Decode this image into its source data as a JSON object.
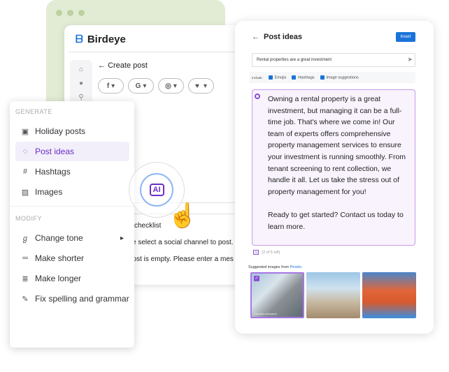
{
  "app": {
    "brand": "Birdeye",
    "page_title": "Create post",
    "sidebar_icons": [
      "home-icon",
      "chat-icon",
      "user-icon"
    ],
    "channels": [
      {
        "icon": "facebook-icon",
        "glyph": "f"
      },
      {
        "icon": "google-icon",
        "glyph": "G"
      },
      {
        "icon": "instagram-icon",
        "glyph": "◎"
      },
      {
        "icon": "twitter-icon",
        "glyph": "🐦"
      }
    ],
    "checklist_label": "checklist",
    "warning1": "se select a social channel to post.",
    "warning2": "post is empty. Please enter a mes"
  },
  "menu": {
    "generate_label": "GENERATE",
    "generate": [
      {
        "label": "Holiday posts",
        "icon": "calendar-icon",
        "glyph": "▣"
      },
      {
        "label": "Post ideas",
        "icon": "lightbulb-icon",
        "glyph": "◌",
        "active": true
      },
      {
        "label": "Hashtags",
        "icon": "hashtag-icon",
        "glyph": "#"
      },
      {
        "label": "Images",
        "icon": "image-icon",
        "glyph": "▨"
      }
    ],
    "modify_label": "MODIFY",
    "modify": [
      {
        "label": "Change tone",
        "icon": "tone-icon",
        "glyph": "ℊ",
        "arrow": "▸"
      },
      {
        "label": "Make shorter",
        "icon": "shorter-icon",
        "glyph": "═"
      },
      {
        "label": "Make longer",
        "icon": "longer-icon",
        "glyph": "≣"
      },
      {
        "label": "Fix spelling and grammar",
        "icon": "spellcheck-icon",
        "glyph": "✎"
      }
    ]
  },
  "ai_button": "AI",
  "panel": {
    "title": "Post ideas",
    "back": "←",
    "insert": "Insert",
    "prompt": "Rental properties are a great investment",
    "include_label": "Include:",
    "options": [
      "Emojis",
      "Hashtags",
      "Image suggestions"
    ],
    "post_text": "Owning a rental property is a great investment, but managing it can be a full-time job. That's where we come in! Our team of experts offers comprehensive property management services to ensure your investment is running smoothly. From tenant screening to rent collection, we handle it all. Let us take the stress out of property management for you!",
    "post_cta": "Ready to get started? Contact us today to learn more.",
    "remaining": "(2 of 5 left)",
    "suggested_label": "Suggested images from",
    "suggested_source": "Pexels",
    "image_caption": "Ceramic artesanal"
  },
  "colors": {
    "accent": "#6b2fc9",
    "primary": "#1a73d9",
    "backdrop": "#e2ecd4"
  }
}
